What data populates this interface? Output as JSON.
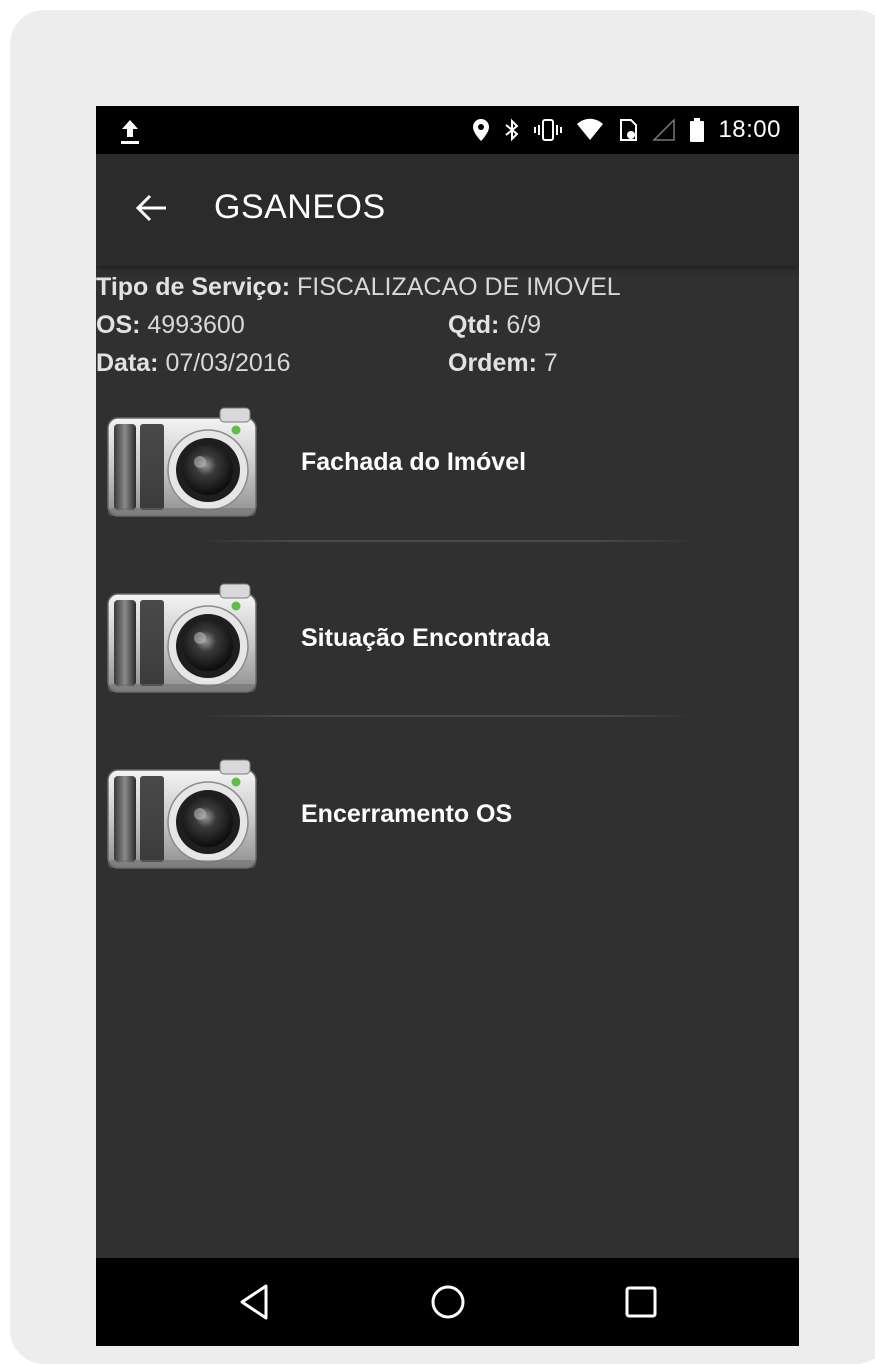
{
  "status_bar": {
    "time": "18:00",
    "icons": [
      "upload-icon",
      "location-icon",
      "bluetooth-icon",
      "vibrate-icon",
      "wifi-icon",
      "sim-icon",
      "signal-icon",
      "battery-icon"
    ]
  },
  "app_bar": {
    "title": "GSANEOS",
    "back_icon": "arrow-back-icon"
  },
  "info": {
    "tipo_label": "Tipo de Serviço:",
    "tipo_value": " FISCALIZACAO DE IMOVEL",
    "os_label": "OS:",
    "os_value": " 4993600",
    "qtd_label": "Qtd:",
    "qtd_value": " 6/9",
    "data_label": "Data:",
    "data_value": " 07/03/2016",
    "ordem_label": "Ordem:",
    "ordem_value": " 7"
  },
  "photo_items": [
    {
      "label": "Fachada do Imóvel",
      "icon": "camera-icon"
    },
    {
      "label": "Situação Encontrada",
      "icon": "camera-icon"
    },
    {
      "label": "Encerramento OS",
      "icon": "camera-icon"
    }
  ],
  "nav_bar": {
    "icons": [
      "back-triangle-icon",
      "home-circle-icon",
      "recents-square-icon"
    ]
  },
  "colors": {
    "screen_bg": "#303030",
    "app_bar_bg": "#2b2b2b",
    "status_bar_bg": "#000000",
    "accent_led": "#5bbf4a"
  }
}
